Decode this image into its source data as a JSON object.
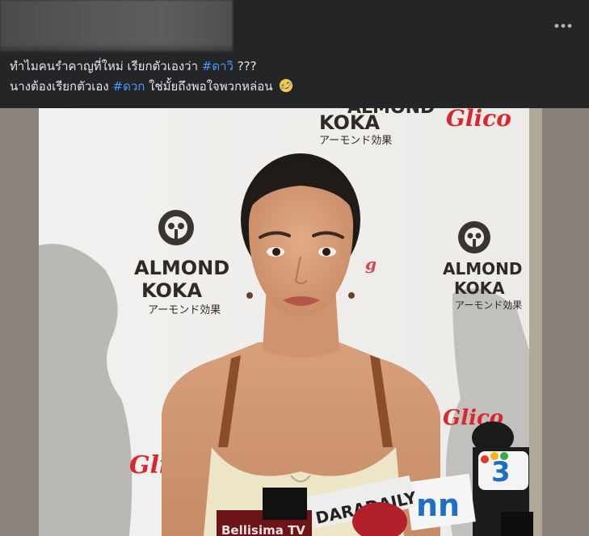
{
  "post": {
    "menu_icon": "more-horizontal-icon",
    "caption": {
      "line1_text": "ทำไมคนรำคาญที่ใหม่ เรียกตัวเองว่า ",
      "line1_hashtag": "#ดาวิ",
      "line1_suffix": " ???",
      "line2_text": "นางต้องเรียกตัวเอง ",
      "line2_hashtag": "#ดวก",
      "line2_suffix": " ใช่มั้ยถึงพอใจพวกหล่อน",
      "emoji": "rolling-on-floor-laughing-emoji"
    },
    "photo": {
      "backdrop_brand": "ALMOND",
      "backdrop_brand2": "KOKA",
      "backdrop_japanese": "アーモンド効果",
      "backdrop_logo2": "Glico",
      "mic_label_1": "DARADAILY",
      "mic_label_2": "nn",
      "mic_label_3": "3",
      "mic_label_4": "Bellisima TV"
    }
  },
  "colors": {
    "background": "#242526",
    "text": "#e4e6eb",
    "hashtag": "#4599ff",
    "glico_red": "#d9272e"
  }
}
